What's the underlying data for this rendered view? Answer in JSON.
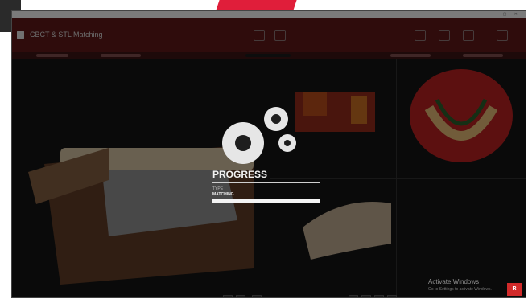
{
  "app": {
    "header_title": "CBCT & STL Matching"
  },
  "progress": {
    "heading": "PROGRESS",
    "type_label": "TYPE",
    "type_value": "MATCHING",
    "fraction": 1.0
  },
  "watermark": {
    "title": "Activate Windows",
    "subtitle": "Go to Settings to activate Windows."
  },
  "colors": {
    "brand_red": "#e01e3a",
    "header_bg": "#5a1818"
  },
  "icons": [
    "gear-icon",
    "window-controls-icon",
    "toolbar-icon"
  ]
}
